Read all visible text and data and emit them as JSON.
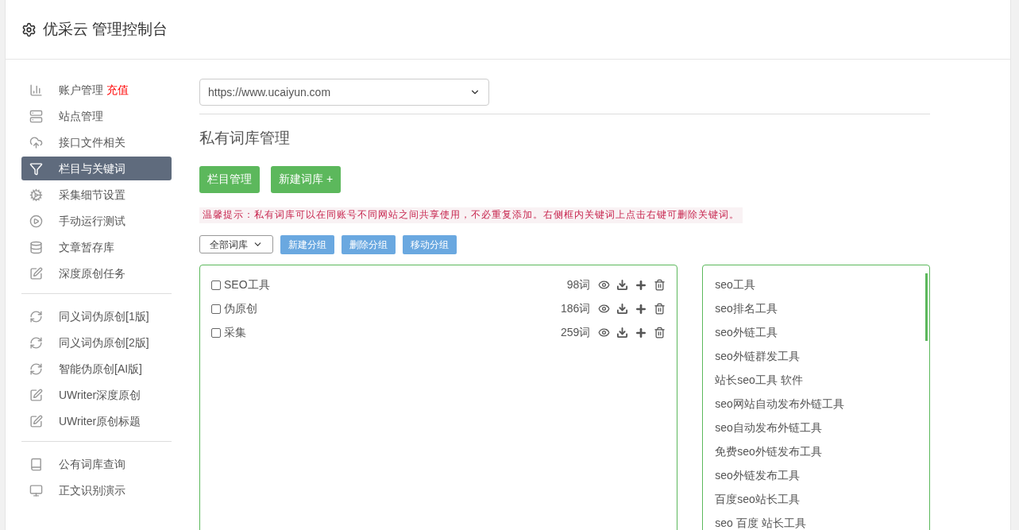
{
  "header": {
    "title": "优采云 管理控制台"
  },
  "sidebar": {
    "groups": [
      {
        "items": [
          {
            "label": "账户管理",
            "badge": "充值",
            "selected": false
          },
          {
            "label": "站点管理",
            "selected": false
          },
          {
            "label": "接口文件相关",
            "selected": false
          },
          {
            "label": "栏目与关键词",
            "selected": true
          },
          {
            "label": "采集细节设置",
            "selected": false
          },
          {
            "label": "手动运行测试",
            "selected": false
          },
          {
            "label": "文章暂存库",
            "selected": false
          },
          {
            "label": "深度原创任务",
            "selected": false
          }
        ]
      },
      {
        "items": [
          {
            "label": "同义词伪原创[1版]",
            "selected": false
          },
          {
            "label": "同义词伪原创[2版]",
            "selected": false
          },
          {
            "label": "智能伪原创[AI版]",
            "selected": false
          },
          {
            "label": "UWriter深度原创",
            "selected": false
          },
          {
            "label": "UWriter原创标题",
            "selected": false
          }
        ]
      },
      {
        "items": [
          {
            "label": "公有词库查询",
            "selected": false
          },
          {
            "label": "正文识别演示",
            "selected": false
          }
        ]
      }
    ]
  },
  "site_select": {
    "value": "https://www.ucaiyun.com"
  },
  "page_title": "私有词库管理",
  "action_buttons": [
    "栏目管理",
    "新建词库 +"
  ],
  "hint": "温馨提示：私有词库可以在同账号不同网站之间共享使用，不必重复添加。右侧框内关键词上点击右键可删除关键词。",
  "filter_select": {
    "value": "全部词库"
  },
  "group_buttons": [
    "新建分组",
    "删除分组",
    "移动分组"
  ],
  "libraries": [
    {
      "name": "SEO工具",
      "count": "98词",
      "checked": false
    },
    {
      "name": "伪原创",
      "count": "186词",
      "checked": false
    },
    {
      "name": "采集",
      "count": "259词",
      "checked": false
    }
  ],
  "keywords": [
    "seo工具",
    "seo排名工具",
    "seo外链工具",
    "seo外链群发工具",
    "站长seo工具 软件",
    "seo网站自动发布外链工具",
    "seo自动发布外链工具",
    "免费seo外链发布工具",
    "seo外链发布工具",
    "百度seo站长工具",
    "seo 百度 站长工具"
  ]
}
